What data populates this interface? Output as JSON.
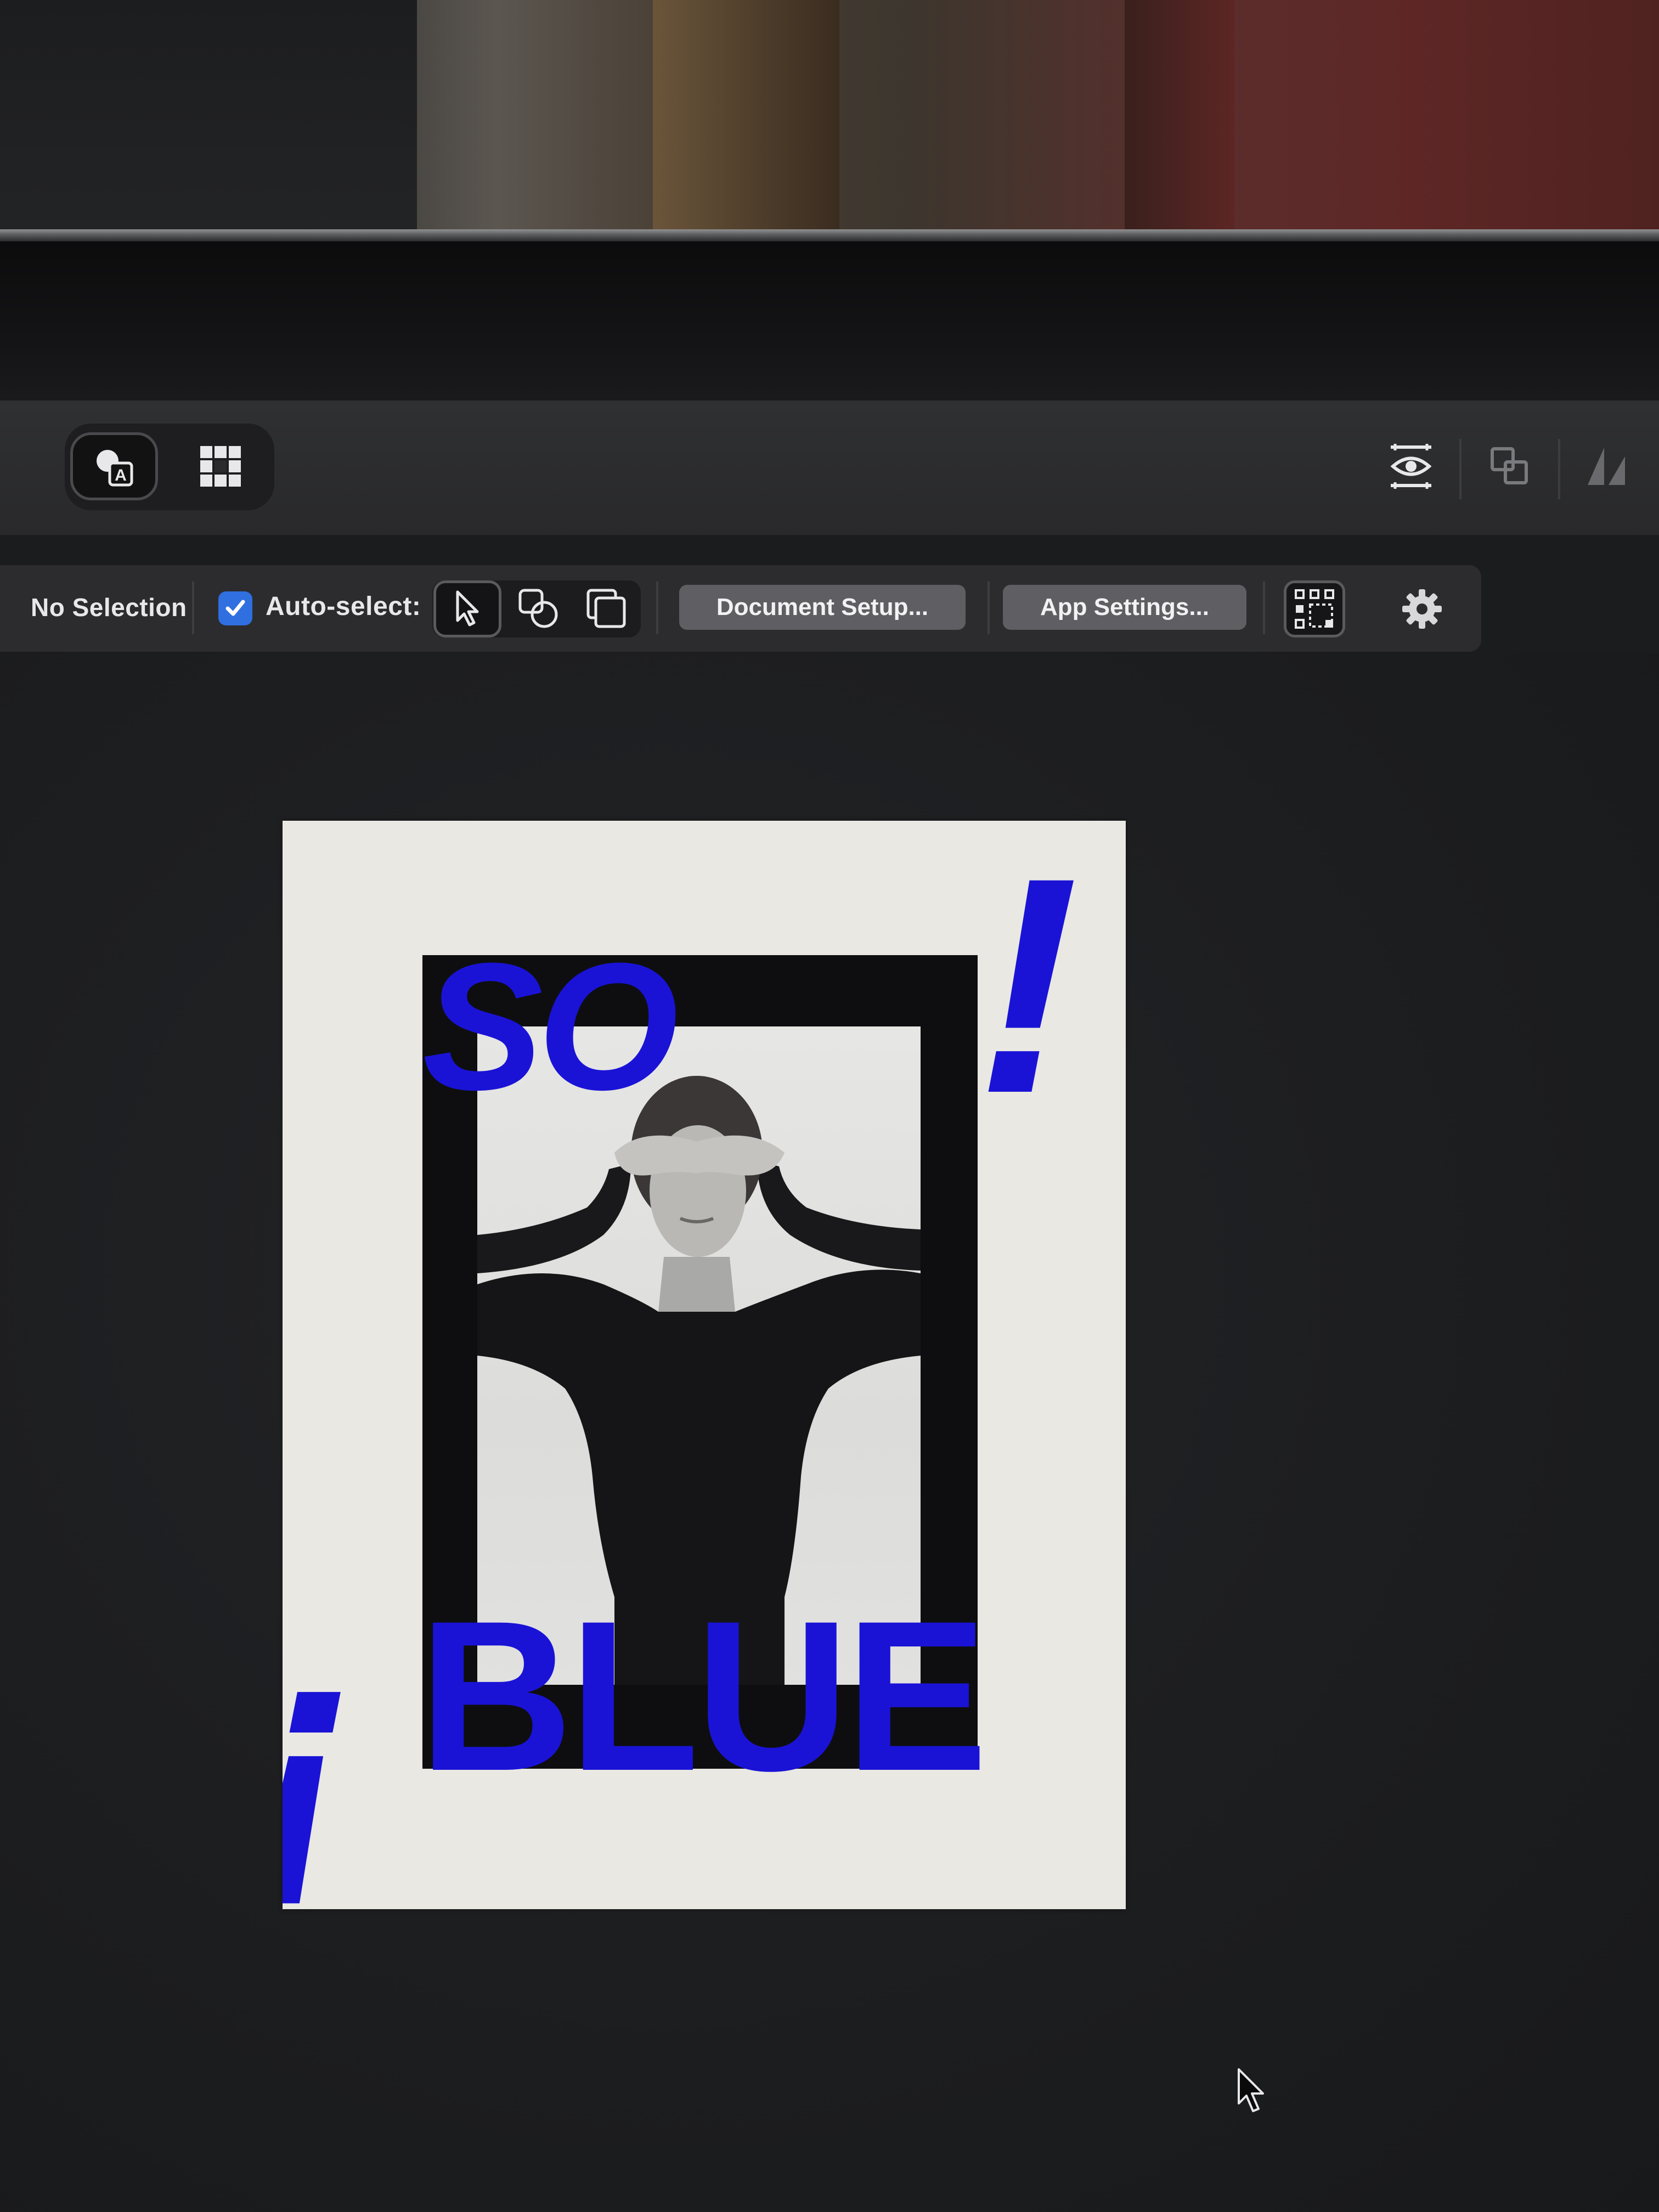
{
  "toolbar": {
    "personas": [
      {
        "icon": "designer-persona-icon",
        "active": true
      },
      {
        "icon": "grid-persona-icon",
        "active": false
      }
    ],
    "right_icons": [
      "preview-mode-icon",
      "export-layers-icon",
      "publisher-icon"
    ]
  },
  "context_toolbar": {
    "selection_label": "No Selection",
    "auto_select": {
      "checked": true,
      "label": "Auto-select:"
    },
    "selection_modes": [
      "pointer-mode-icon",
      "intersect-mode-icon",
      "layer-mode-icon"
    ],
    "document_setup_label": "Document Setup...",
    "app_settings_label": "App Settings...",
    "snapping_icon": "snapping-icon",
    "settings_icon": "gear-icon"
  },
  "poster": {
    "word_top": "SO",
    "word_bottom": "BLUE",
    "exclamation_top": "!",
    "exclamation_bottom": "¡",
    "text_color": "#1a13d6",
    "paper_color": "#e9e8e3"
  },
  "colors": {
    "accent_checkbox": "#2f6fe0",
    "toolbar_bg": "#2c2c2e"
  }
}
